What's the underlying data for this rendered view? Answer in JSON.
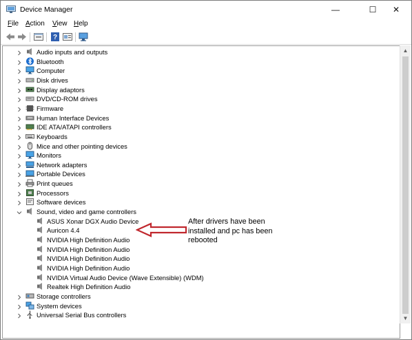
{
  "window": {
    "title": "Device Manager",
    "controls": {
      "minimize": "—",
      "maximize": "☐",
      "close": "✕"
    }
  },
  "menu": [
    {
      "label": "File",
      "mnemonic": "F",
      "rest": "ile"
    },
    {
      "label": "Action",
      "mnemonic": "A",
      "rest": "ction"
    },
    {
      "label": "View",
      "mnemonic": "V",
      "rest": "iew"
    },
    {
      "label": "Help",
      "mnemonic": "H",
      "rest": "elp"
    }
  ],
  "toolbar": {
    "icons": [
      "back-arrow-icon",
      "forward-arrow-icon",
      "properties-icon",
      "help-icon",
      "properties-sheet-icon",
      "scan-hardware-icon"
    ]
  },
  "tree": {
    "categories": [
      {
        "label": "Audio inputs and outputs",
        "icon": "speaker-icon",
        "expanded": false
      },
      {
        "label": "Bluetooth",
        "icon": "bluetooth-icon",
        "expanded": false
      },
      {
        "label": "Computer",
        "icon": "monitor-icon",
        "expanded": false
      },
      {
        "label": "Disk drives",
        "icon": "disk-drive-icon",
        "expanded": false
      },
      {
        "label": "Display adaptors",
        "icon": "display-adapter-icon",
        "expanded": false
      },
      {
        "label": "DVD/CD-ROM drives",
        "icon": "optical-drive-icon",
        "expanded": false
      },
      {
        "label": "Firmware",
        "icon": "firmware-icon",
        "expanded": false
      },
      {
        "label": "Human Interface Devices",
        "icon": "hid-icon",
        "expanded": false
      },
      {
        "label": "IDE ATA/ATAPI controllers",
        "icon": "ide-controller-icon",
        "expanded": false
      },
      {
        "label": "Keyboards",
        "icon": "keyboard-icon",
        "expanded": false
      },
      {
        "label": "Mice and other pointing devices",
        "icon": "mouse-icon",
        "expanded": false
      },
      {
        "label": "Monitors",
        "icon": "monitor-icon",
        "expanded": false
      },
      {
        "label": "Network adapters",
        "icon": "network-adapter-icon",
        "expanded": false
      },
      {
        "label": "Portable Devices",
        "icon": "portable-device-icon",
        "expanded": false
      },
      {
        "label": "Print queues",
        "icon": "printer-icon",
        "expanded": false
      },
      {
        "label": "Processors",
        "icon": "processor-icon",
        "expanded": false
      },
      {
        "label": "Software devices",
        "icon": "software-device-icon",
        "expanded": false
      },
      {
        "label": "Sound, video and game controllers",
        "icon": "speaker-icon",
        "expanded": true,
        "children": [
          "ASUS Xonar DGX Audio Device",
          "Auricon 4.4",
          "NVIDIA High Definition Audio",
          "NVIDIA High Definition Audio",
          "NVIDIA High Definition Audio",
          "NVIDIA High Definition Audio",
          "NVIDIA Virtual Audio Device (Wave Extensible) (WDM)",
          "Realtek High Definition Audio"
        ]
      },
      {
        "label": "Storage controllers",
        "icon": "storage-controller-icon",
        "expanded": false
      },
      {
        "label": "System devices",
        "icon": "system-devices-icon",
        "expanded": false
      },
      {
        "label": "Universal Serial Bus controllers",
        "icon": "usb-icon",
        "expanded": false
      }
    ]
  },
  "annotation": {
    "text": "After drivers have been installed and pc has been rebooted",
    "arrow_color": "#c0272d"
  }
}
